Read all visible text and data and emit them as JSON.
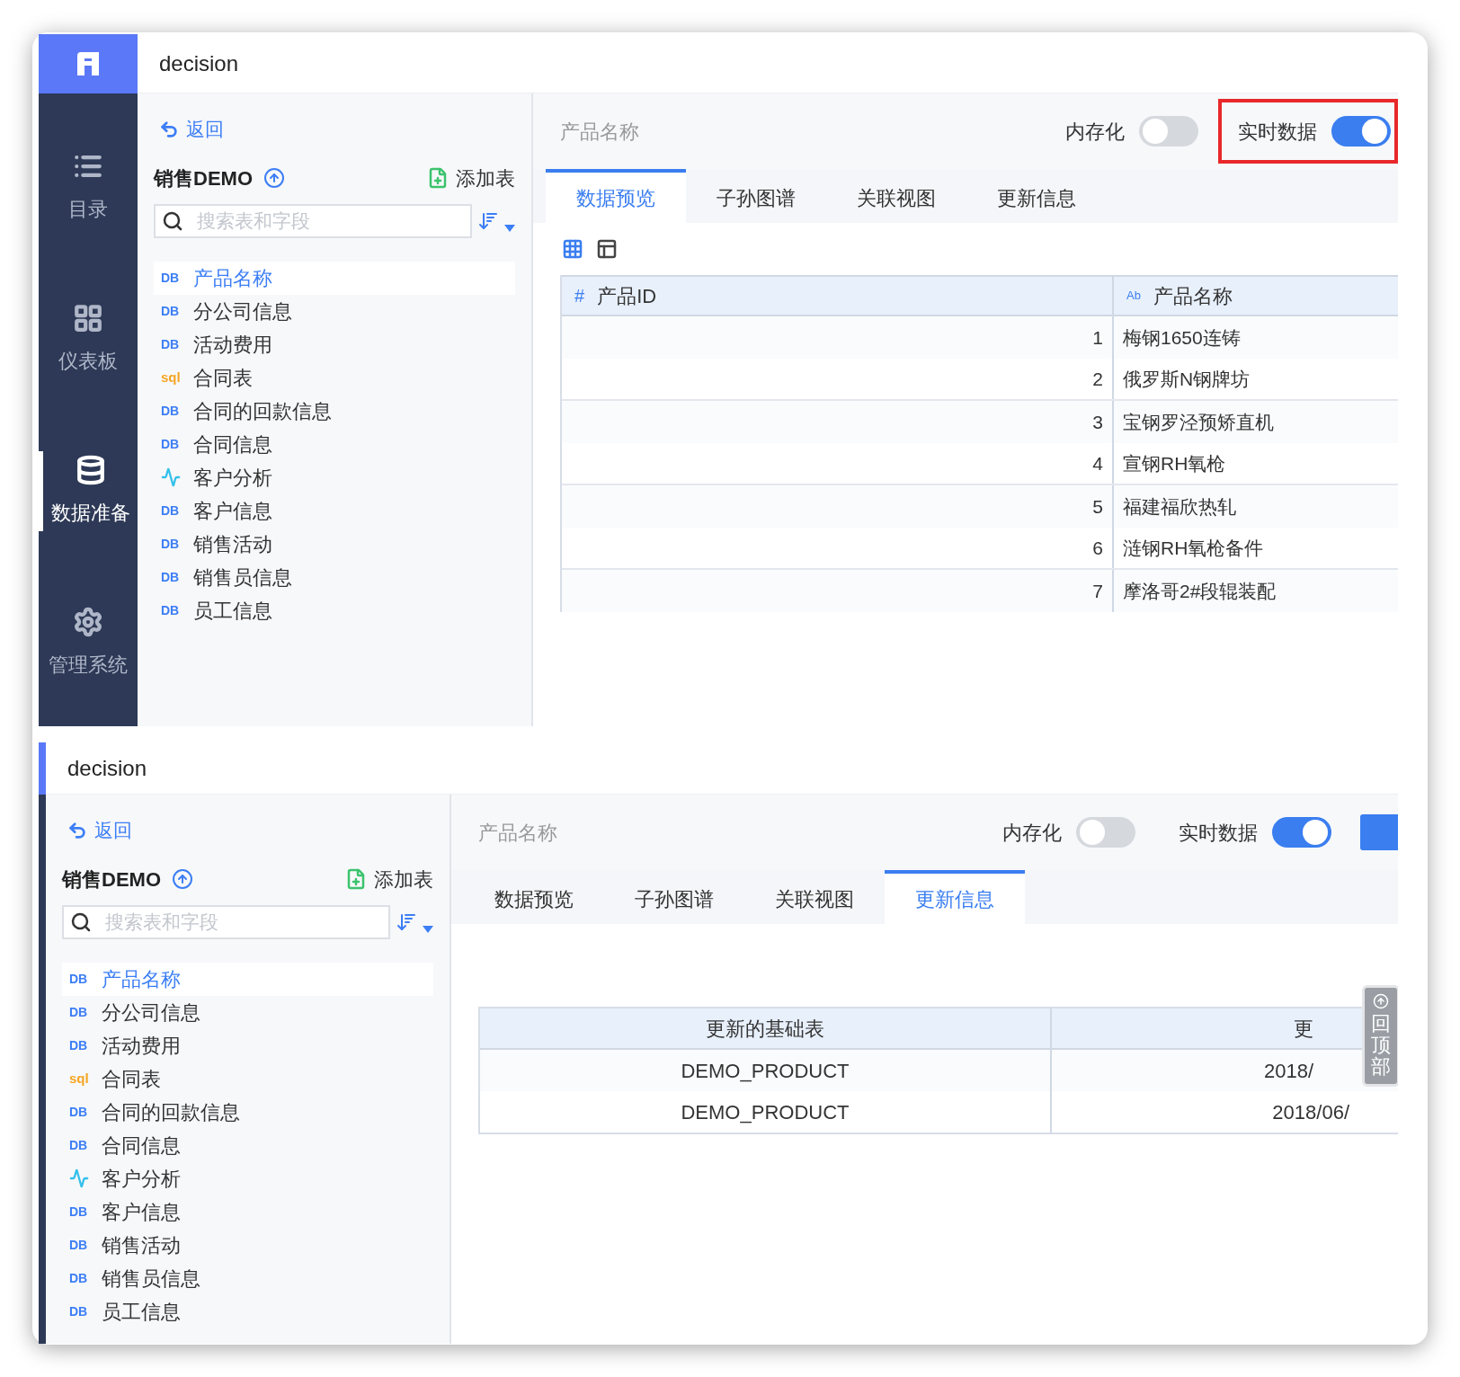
{
  "screens": [
    {
      "app_title": "decision",
      "nav": [
        {
          "label": "目录",
          "kind": "list",
          "selected": false
        },
        {
          "label": "仪表板",
          "kind": "grid",
          "selected": false
        },
        {
          "label": "数据准备",
          "kind": "database",
          "selected": true
        },
        {
          "label": "管理系统",
          "kind": "gear",
          "selected": false
        }
      ],
      "panel": {
        "back": "返回",
        "title": "销售DEMO",
        "add": "添加表",
        "search_placeholder": "搜索表和字段",
        "tables": [
          {
            "kind": "db",
            "tag": "DB",
            "name": "产品名称",
            "selected": true
          },
          {
            "kind": "db",
            "tag": "DB",
            "name": "分公司信息",
            "selected": false
          },
          {
            "kind": "db",
            "tag": "DB",
            "name": "活动费用",
            "selected": false
          },
          {
            "kind": "sql",
            "tag": "sql",
            "name": "合同表",
            "selected": false
          },
          {
            "kind": "db",
            "tag": "DB",
            "name": "合同的回款信息",
            "selected": false
          },
          {
            "kind": "db",
            "tag": "DB",
            "name": "合同信息",
            "selected": false
          },
          {
            "kind": "analysis",
            "name": "客户分析",
            "selected": false
          },
          {
            "kind": "db",
            "tag": "DB",
            "name": "客户信息",
            "selected": false
          },
          {
            "kind": "db",
            "tag": "DB",
            "name": "销售活动",
            "selected": false
          },
          {
            "kind": "db",
            "tag": "DB",
            "name": "销售员信息",
            "selected": false
          },
          {
            "kind": "db",
            "tag": "DB",
            "name": "员工信息",
            "selected": false
          }
        ]
      },
      "main": {
        "title": "产品名称",
        "toggles": [
          {
            "label": "内存化",
            "on": false
          },
          {
            "label": "实时数据",
            "on": true,
            "highlighted": true
          }
        ],
        "tabs": [
          {
            "label": "数据预览",
            "selected": true
          },
          {
            "label": "子孙图谱",
            "selected": false
          },
          {
            "label": "关联视图",
            "selected": false
          },
          {
            "label": "更新信息",
            "selected": false
          }
        ],
        "table": {
          "kind": "preview",
          "columns": [
            {
              "type_mark": "#",
              "label": "产品ID"
            },
            {
              "type_mark": "Ab",
              "label": "产品名称"
            }
          ],
          "rows": [
            [
              "1",
              "梅钢1650连铸"
            ],
            [
              "2",
              "俄罗斯N钢牌坊"
            ],
            [
              "3",
              "宝钢罗泾预矫直机"
            ],
            [
              "4",
              "宣钢RH氧枪"
            ],
            [
              "5",
              "福建福欣热轧"
            ],
            [
              "6",
              "涟钢RH氧枪备件"
            ],
            [
              "7",
              "摩洛哥2#段辊装配"
            ]
          ]
        }
      }
    },
    {
      "app_title": "decision",
      "panel": {
        "back": "返回",
        "title": "销售DEMO",
        "add": "添加表",
        "search_placeholder": "搜索表和字段",
        "tables": [
          {
            "kind": "db",
            "tag": "DB",
            "name": "产品名称",
            "selected": true
          },
          {
            "kind": "db",
            "tag": "DB",
            "name": "分公司信息",
            "selected": false
          },
          {
            "kind": "db",
            "tag": "DB",
            "name": "活动费用",
            "selected": false
          },
          {
            "kind": "sql",
            "tag": "sql",
            "name": "合同表",
            "selected": false
          },
          {
            "kind": "db",
            "tag": "DB",
            "name": "合同的回款信息",
            "selected": false
          },
          {
            "kind": "db",
            "tag": "DB",
            "name": "合同信息",
            "selected": false
          },
          {
            "kind": "analysis",
            "name": "客户分析",
            "selected": false
          },
          {
            "kind": "db",
            "tag": "DB",
            "name": "客户信息",
            "selected": false
          },
          {
            "kind": "db",
            "tag": "DB",
            "name": "销售活动",
            "selected": false
          },
          {
            "kind": "db",
            "tag": "DB",
            "name": "销售员信息",
            "selected": false
          },
          {
            "kind": "db",
            "tag": "DB",
            "name": "员工信息",
            "selected": false
          }
        ]
      },
      "main": {
        "title": "产品名称",
        "toggles": [
          {
            "label": "内存化",
            "on": false
          },
          {
            "label": "实时数据",
            "on": true
          }
        ],
        "action_button": true,
        "tabs": [
          {
            "label": "数据预览",
            "selected": false
          },
          {
            "label": "子孙图谱",
            "selected": false
          },
          {
            "label": "关联视图",
            "selected": false
          },
          {
            "label": "更新信息",
            "selected": true
          }
        ],
        "table": {
          "kind": "update",
          "columns": [
            {
              "label": "更新的基础表"
            },
            {
              "label": "更"
            }
          ],
          "rows": [
            [
              "DEMO_PRODUCT",
              "2018/"
            ],
            [
              "DEMO_PRODUCT",
              "2018/06/"
            ]
          ]
        },
        "back_to_top": "回顶部"
      }
    }
  ]
}
